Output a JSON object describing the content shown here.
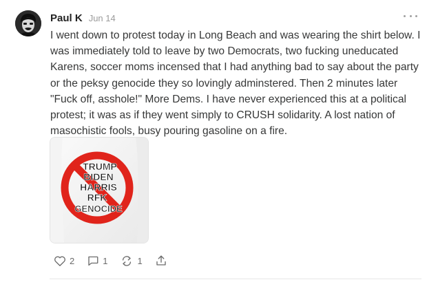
{
  "comment": {
    "author": "Paul K",
    "date": "Jun 14",
    "body": "I went down to protest today in Long Beach and was wearing the shirt below. I was immediately told to leave by two Democrats, two fucking uneducated Karens, soccer moms incensed that I had anything bad to say about the party or the peksy genocide they so lovingly adminstered. Then 2 minutes later \"Fuck off, asshole!\" More Dems. I have never experienced this at a political protest; it was as if they went simply to CRUSH solidarity. A lost nation of masochistic fools, busy pouring gasoline on a fire.",
    "image": {
      "lines": [
        "TRUMP",
        "BIDEN",
        "HARRIS",
        "RFK",
        "GENOCIDE"
      ],
      "symbol_color": "#e0241b"
    },
    "actions": {
      "likes": "2",
      "replies": "1",
      "restacks": "1"
    }
  },
  "icons": {
    "like": "heart-icon",
    "reply": "comment-bubble-icon",
    "restack": "restack-arrows-icon",
    "share": "share-icon",
    "more": "more-dots-icon"
  }
}
